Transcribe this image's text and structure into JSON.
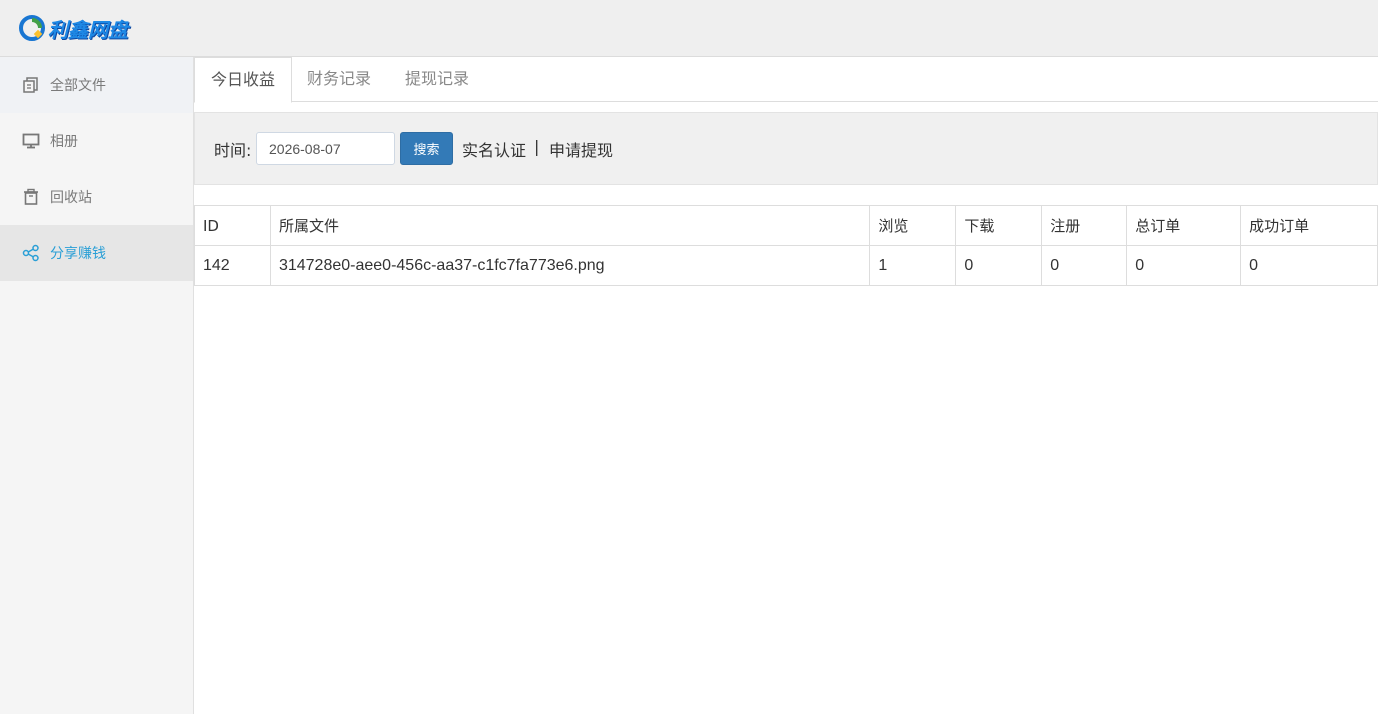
{
  "app": {
    "logo_text": "利鑫网盘"
  },
  "sidebar": {
    "items": [
      {
        "label": "全部文件",
        "icon": "files-icon"
      },
      {
        "label": "相册",
        "icon": "monitor-icon"
      },
      {
        "label": "回收站",
        "icon": "trash-icon"
      },
      {
        "label": "分享赚钱",
        "icon": "share-icon",
        "active": true
      }
    ]
  },
  "tabs": [
    {
      "label": "今日收益",
      "active": true
    },
    {
      "label": "财务记录"
    },
    {
      "label": "提现记录"
    }
  ],
  "search": {
    "time_label": "时间:",
    "date_value": "2026-08-07",
    "button_label": "搜索",
    "verify_link": "实名认证",
    "separator": "|",
    "withdraw_link": "申请提现"
  },
  "table": {
    "headers": [
      "ID",
      "所属文件",
      "浏览",
      "下载",
      "注册",
      "总订单",
      "成功订单"
    ],
    "rows": [
      [
        "142",
        "314728e0-aee0-456c-aa37-c1fc7fa773e6.png",
        "1",
        "0",
        "0",
        "0",
        "0"
      ]
    ]
  },
  "colors": {
    "accent": "#337ab7",
    "active_nav": "#2a9fd6"
  }
}
